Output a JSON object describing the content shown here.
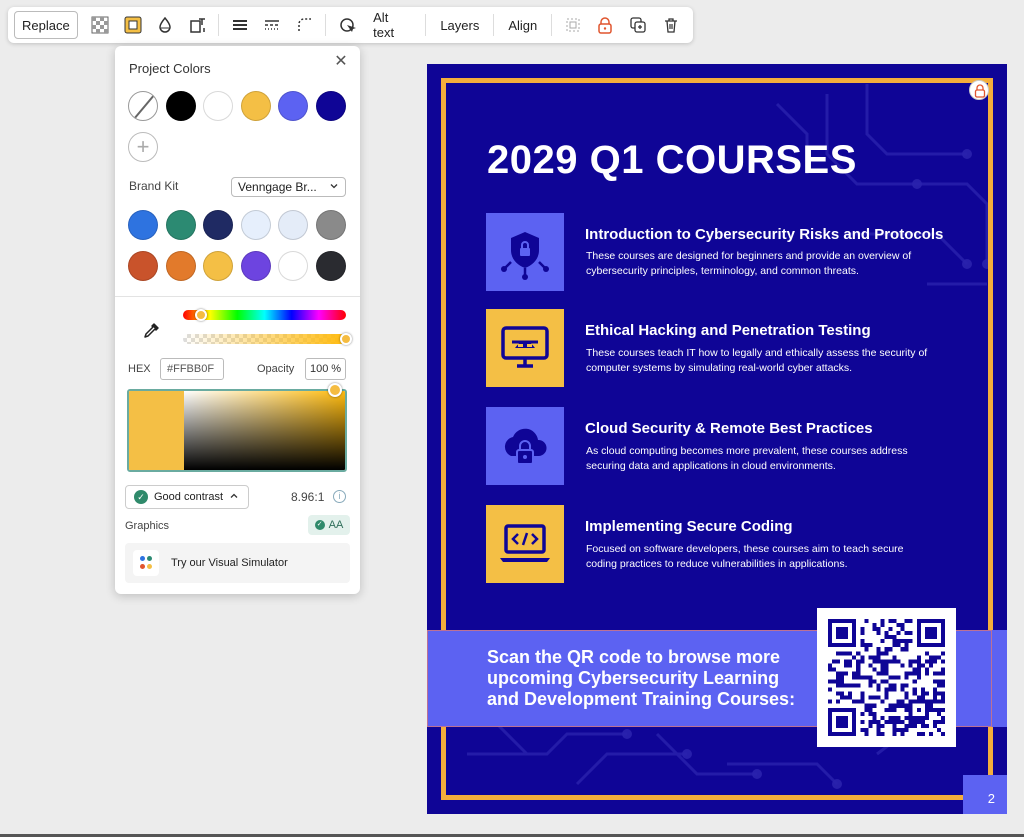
{
  "toolbar": {
    "replace_label": "Replace",
    "alt_text_label": "Alt text",
    "layers_label": "Layers",
    "align_label": "Align",
    "icons": [
      "transparency-icon",
      "border-color-icon",
      "fill-icon",
      "crop-resize-icon",
      "line-weight-icon",
      "dash-style-icon",
      "corner-radius-icon",
      "animate-icon",
      "group-icon",
      "lock-icon",
      "duplicate-icon",
      "trash-icon"
    ]
  },
  "color_panel": {
    "title": "Project Colors",
    "project_colors": [
      "none",
      "#000000",
      "#FFFFFF",
      "#F4BF45",
      "#5C62F2",
      "#0F0596"
    ],
    "brand_kit_label": "Brand Kit",
    "brand_kit_value": "Venngage Br...",
    "brand_colors": [
      "#2E73E0",
      "#2C8A72",
      "#1F2A63",
      "#E6EFFC",
      "#E4ECF8",
      "#8A8A8A",
      "#C9532B",
      "#E27A2B",
      "#F4BF45",
      "#6D44E0",
      "#FFFFFF",
      "#2A2B30"
    ],
    "hex_label": "HEX",
    "hex_value": "#FFBB0F",
    "opacity_label": "Opacity",
    "opacity_value": "100",
    "opacity_unit": "%",
    "contrast_label": "Good contrast",
    "contrast_ratio": "8.96:1",
    "graphics_label": "Graphics",
    "aa_label": "AA",
    "simulator_label": "Try our Visual Simulator"
  },
  "poster": {
    "title": "2029 Q1 COURSES",
    "courses": [
      {
        "title": "Introduction to Cybersecurity Risks and Protocols",
        "description": "These courses are designed for beginners and provide an overview of cybersecurity principles, terminology, and common threats.",
        "icon": "shield-lock-icon"
      },
      {
        "title": "Ethical Hacking and Penetration Testing",
        "description": "These courses teach IT how to legally and ethically assess the security of computer systems by simulating real-world cyber attacks.",
        "icon": "monitor-hacker-icon"
      },
      {
        "title": "Cloud Security & Remote Best Practices",
        "description": "As cloud computing becomes more prevalent, these courses address securing data and applications in cloud environments.",
        "icon": "cloud-lock-icon"
      },
      {
        "title": "Implementing Secure Coding",
        "description": "Focused on software developers, these courses aim to teach secure coding practices to reduce vulnerabilities in applications.",
        "icon": "laptop-code-icon"
      }
    ],
    "cta": "Scan the QR code to browse more upcoming Cybersecurity Learning and Development Training Courses:",
    "page_number": "2",
    "colors": {
      "background": "#0F0596",
      "accent": "#F4AE3C",
      "band": "#5C62F2"
    }
  }
}
